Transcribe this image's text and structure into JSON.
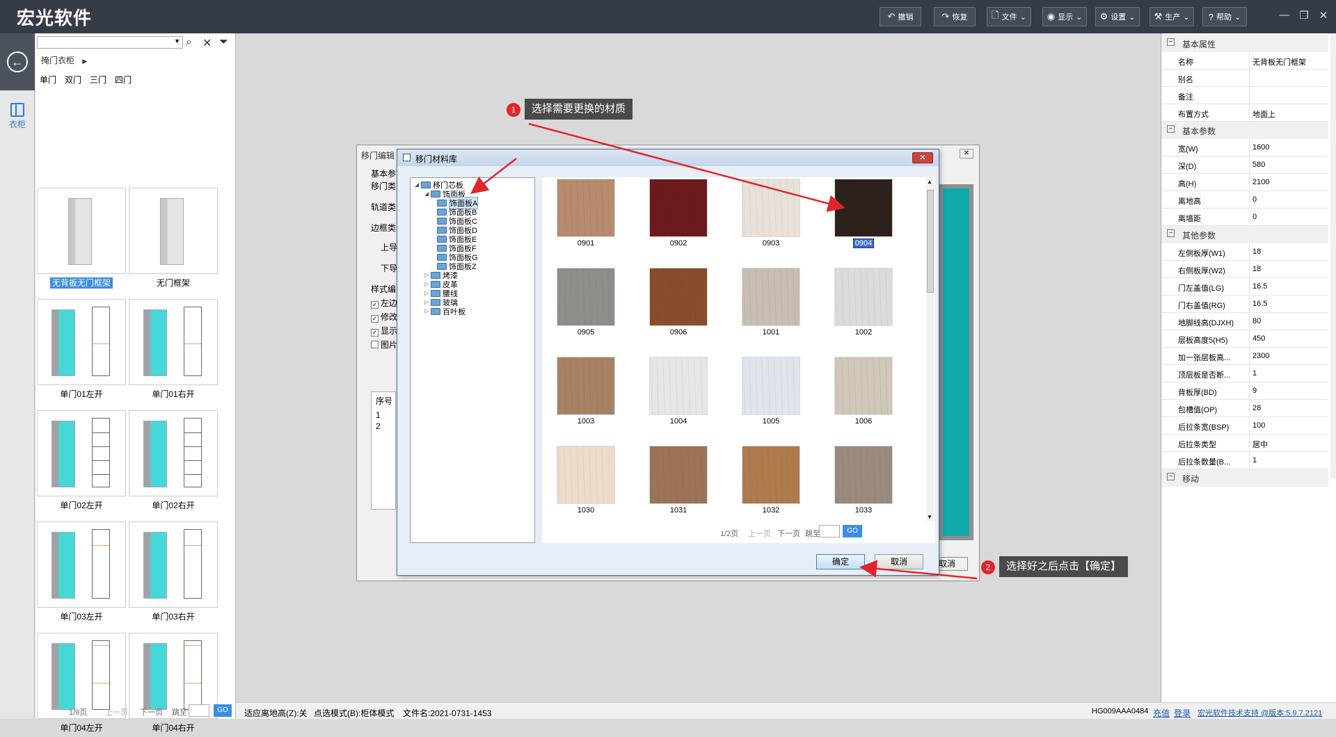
{
  "app": {
    "title": "宏光软件"
  },
  "toolbar": {
    "undo": "撤销",
    "redo": "恢复",
    "file": "文件",
    "display": "显示",
    "settings": "设置",
    "production": "生产",
    "help": "帮助"
  },
  "left": {
    "breadcrumb": "掩门衣柜",
    "door_tabs": [
      "单门",
      "双门",
      "三门",
      "四门"
    ],
    "side_tab": "衣柜",
    "items": [
      {
        "label": "无背板无门框架",
        "selected": true
      },
      {
        "label": "无门框架"
      },
      {
        "label": "单门01左开"
      },
      {
        "label": "单门01右开"
      },
      {
        "label": "单门02左开"
      },
      {
        "label": "单门02右开"
      },
      {
        "label": "单门03左开"
      },
      {
        "label": "单门03右开"
      },
      {
        "label": "单门04左开"
      },
      {
        "label": "单门04右开"
      }
    ],
    "pager": {
      "page": "1/9页",
      "prev": "上一页",
      "next": "下一页",
      "jump": "跳至",
      "go": "GO"
    }
  },
  "dialog_back": {
    "title": "移门编辑",
    "labels": [
      "基本参",
      "移门类",
      "轨道类",
      "边框类",
      "上导",
      "下导",
      "样式编"
    ],
    "checks": [
      "左边",
      "修改",
      "显示",
      "图片"
    ],
    "table_header": "序号",
    "rows": [
      "1",
      "2"
    ],
    "cancel": "取消"
  },
  "dialog": {
    "title": "移门材料库",
    "close": "✕",
    "tree": {
      "root": "移门芯板",
      "open": "饰面板",
      "children": [
        "饰面板A",
        "饰面板B",
        "饰面板C",
        "饰面板D",
        "饰面板E",
        "饰面板F",
        "饰面板G",
        "饰面板Z"
      ],
      "others": [
        "烤漆",
        "皮革",
        "腰线",
        "玻璃",
        "百叶板"
      ]
    },
    "materials": [
      {
        "name": "0901",
        "color": "#b88a6e"
      },
      {
        "name": "0902",
        "color": "#6d1a1c"
      },
      {
        "name": "0903",
        "color": "#e7e1da"
      },
      {
        "name": "0904",
        "color": "#2d211c",
        "selected": true
      },
      {
        "name": "0905",
        "color": "#8f8d87"
      },
      {
        "name": "0906",
        "color": "#8a4d2a"
      },
      {
        "name": "1001",
        "color": "#c7bdb2"
      },
      {
        "name": "1002",
        "color": "#dcdbd9"
      },
      {
        "name": "1003",
        "color": "#a98165"
      },
      {
        "name": "1004",
        "color": "#e6e6e4"
      },
      {
        "name": "1005",
        "color": "#e0e5ec"
      },
      {
        "name": "1006",
        "color": "#cfc7b8"
      },
      {
        "name": "1030",
        "color": "#ecdccc"
      },
      {
        "name": "1031",
        "color": "#9c7356"
      },
      {
        "name": "1032",
        "color": "#b07a4f"
      },
      {
        "name": "1033",
        "color": "#9a8a7d"
      }
    ],
    "pager": {
      "page": "1/2页",
      "prev": "上一页",
      "next": "下一页",
      "jump": "跳至",
      "go": "GO"
    },
    "ok": "确定",
    "cancel": "取消"
  },
  "callouts": [
    {
      "num": "1",
      "text": "选择需要更换的材质"
    },
    {
      "num": "2",
      "text": "选择好之后点击【确定】"
    }
  ],
  "props": {
    "sections": [
      {
        "title": "基本属性",
        "rows": [
          {
            "k": "名称",
            "v": "无背板无门框架"
          },
          {
            "k": "别名",
            "v": ""
          },
          {
            "k": "备注",
            "v": ""
          },
          {
            "k": "布置方式",
            "v": "地面上"
          }
        ]
      },
      {
        "title": "基本参数",
        "rows": [
          {
            "k": "宽(W)",
            "v": "1600"
          },
          {
            "k": "深(D)",
            "v": "580"
          },
          {
            "k": "高(H)",
            "v": "2100"
          },
          {
            "k": "离地高",
            "v": "0"
          },
          {
            "k": "离墙距",
            "v": "0"
          }
        ]
      },
      {
        "title": "其他参数",
        "rows": [
          {
            "k": "左侧板厚(W1)",
            "v": "18"
          },
          {
            "k": "右侧板厚(W2)",
            "v": "18"
          },
          {
            "k": "门左盖值(LG)",
            "v": "16.5"
          },
          {
            "k": "门右盖值(RG)",
            "v": "16.5"
          },
          {
            "k": "地脚线高(DJXH)",
            "v": "80"
          },
          {
            "k": "层板高度5(H5)",
            "v": "450"
          },
          {
            "k": "加一张层板高...",
            "v": "2300"
          },
          {
            "k": "顶层板是否断...",
            "v": "1"
          },
          {
            "k": "背板厚(BD)",
            "v": "9"
          },
          {
            "k": "包槽值(OP)",
            "v": "28"
          },
          {
            "k": "后拉条宽(BSP)",
            "v": "100"
          },
          {
            "k": "后拉条类型",
            "v": "居中"
          },
          {
            "k": "后拉条数量(B...",
            "v": "1"
          }
        ]
      },
      {
        "title": "移动",
        "rows": []
      }
    ]
  },
  "status": {
    "fit": "适应离地高(Z):关",
    "mode": "点选模式(B):柜体模式",
    "file": "文件名:2021-0731-1453",
    "code": "HG009AAA0484",
    "recharge": "充值",
    "login": "登录",
    "support": "宏光软件技术支持 @版本:5.9.7.2121"
  }
}
